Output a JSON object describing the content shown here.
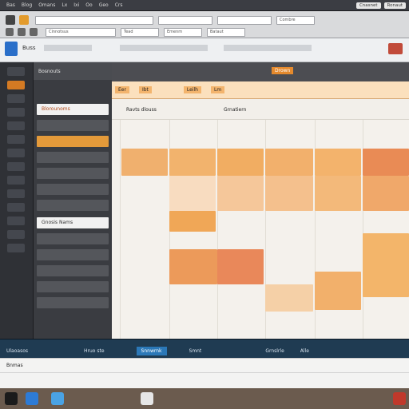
{
  "colors": {
    "accent": "#f2a24b",
    "accent_dark": "#e07d3a",
    "event_red": "#d95b4a",
    "chrome_dark": "#2f3136",
    "bottom_blue": "#1f3b52"
  },
  "menubar": {
    "items": [
      "Bas",
      "Blog",
      "Omans",
      "Lx",
      "Ixi",
      "Oo",
      "Geo",
      "Crs"
    ],
    "right_pill_1": "Cnasnet",
    "right_pill_2": "Ronaut"
  },
  "toolbar": {
    "search_placeholder": "",
    "field_2": "",
    "field_3": "",
    "dropdown": "Combre",
    "buttons": [
      "Cinnotsus",
      "Tead",
      "Emenm",
      "Bataut"
    ]
  },
  "ribbon": {
    "title": "Buss"
  },
  "side": {
    "header": "Bosnouts",
    "selected_item": "Blorounoms",
    "highlighted_item": "Gnosis Nams"
  },
  "calendar": {
    "top_title": "Drown",
    "tabs": [
      "Eer",
      "Ibt",
      "Leilh",
      "Lm"
    ],
    "col_headers": [
      "Ravts dlouss",
      "Grnatiern"
    ],
    "events": []
  },
  "bottom": {
    "items": [
      "Ulaoasos",
      "Hruo ste",
      "Smnt",
      "Grnslrle",
      "Alle"
    ],
    "selected": "Snnwrnk"
  },
  "table": {
    "headers": [
      "Bnmas",
      "",
      "",
      "",
      "",
      "",
      ""
    ]
  }
}
